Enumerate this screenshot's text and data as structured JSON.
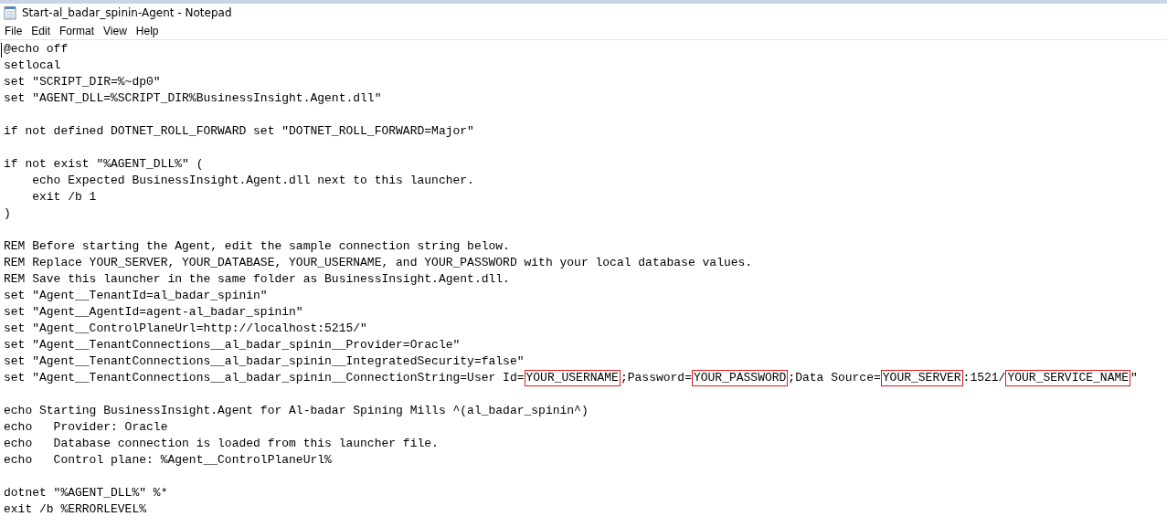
{
  "window": {
    "title": "Start-al_badar_spinin-Agent - Notepad"
  },
  "menu": [
    "File",
    "Edit",
    "Format",
    "View",
    "Help"
  ],
  "editor": {
    "lines": [
      {
        "kind": "text",
        "text": "@echo off"
      },
      {
        "kind": "text",
        "text": "setlocal"
      },
      {
        "kind": "text",
        "text": "set \"SCRIPT_DIR=%~dp0\""
      },
      {
        "kind": "text",
        "text": "set \"AGENT_DLL=%SCRIPT_DIR%BusinessInsight.Agent.dll\""
      },
      {
        "kind": "blank"
      },
      {
        "kind": "text",
        "text": "if not defined DOTNET_ROLL_FORWARD set \"DOTNET_ROLL_FORWARD=Major\""
      },
      {
        "kind": "blank"
      },
      {
        "kind": "text",
        "text": "if not exist \"%AGENT_DLL%\" ("
      },
      {
        "kind": "text",
        "text": "    echo Expected BusinessInsight.Agent.dll next to this launcher."
      },
      {
        "kind": "text",
        "text": "    exit /b 1"
      },
      {
        "kind": "text",
        "text": ")"
      },
      {
        "kind": "blank"
      },
      {
        "kind": "text",
        "text": "REM Before starting the Agent, edit the sample connection string below."
      },
      {
        "kind": "text",
        "text": "REM Replace YOUR_SERVER, YOUR_DATABASE, YOUR_USERNAME, and YOUR_PASSWORD with your local database values."
      },
      {
        "kind": "text",
        "text": "REM Save this launcher in the same folder as BusinessInsight.Agent.dll."
      },
      {
        "kind": "text",
        "text": "set \"Agent__TenantId=al_badar_spinin\""
      },
      {
        "kind": "text",
        "text": "set \"Agent__AgentId=agent-al_badar_spinin\""
      },
      {
        "kind": "text",
        "text": "set \"Agent__ControlPlaneUrl=http://localhost:5215/\""
      },
      {
        "kind": "text",
        "text": "set \"Agent__TenantConnections__al_badar_spinin__Provider=Oracle\""
      },
      {
        "kind": "text",
        "text": "set \"Agent__TenantConnections__al_badar_spinin__IntegratedSecurity=false\""
      },
      {
        "kind": "marked",
        "parts": [
          {
            "text": "set \"Agent__TenantConnections__al_badar_spinin__ConnectionString=User Id=",
            "boxed": false
          },
          {
            "text": "YOUR_USERNAME",
            "boxed": true
          },
          {
            "text": ";Password=",
            "boxed": false
          },
          {
            "text": "YOUR_PASSWORD",
            "boxed": true
          },
          {
            "text": ";Data Source=",
            "boxed": false
          },
          {
            "text": "YOUR_SERVER",
            "boxed": true
          },
          {
            "text": ":1521/",
            "boxed": false
          },
          {
            "text": "YOUR_SERVICE_NAME",
            "boxed": true
          },
          {
            "text": "\"",
            "boxed": false
          }
        ]
      },
      {
        "kind": "blank"
      },
      {
        "kind": "text",
        "text": "echo Starting BusinessInsight.Agent for Al-badar Spining Mills ^(al_badar_spinin^)"
      },
      {
        "kind": "text",
        "text": "echo   Provider: Oracle"
      },
      {
        "kind": "text",
        "text": "echo   Database connection is loaded from this launcher file."
      },
      {
        "kind": "text",
        "text": "echo   Control plane: %Agent__ControlPlaneUrl%"
      },
      {
        "kind": "blank"
      },
      {
        "kind": "text",
        "text": "dotnet \"%AGENT_DLL%\" %*"
      },
      {
        "kind": "text",
        "text": "exit /b %ERRORLEVEL%"
      }
    ]
  }
}
